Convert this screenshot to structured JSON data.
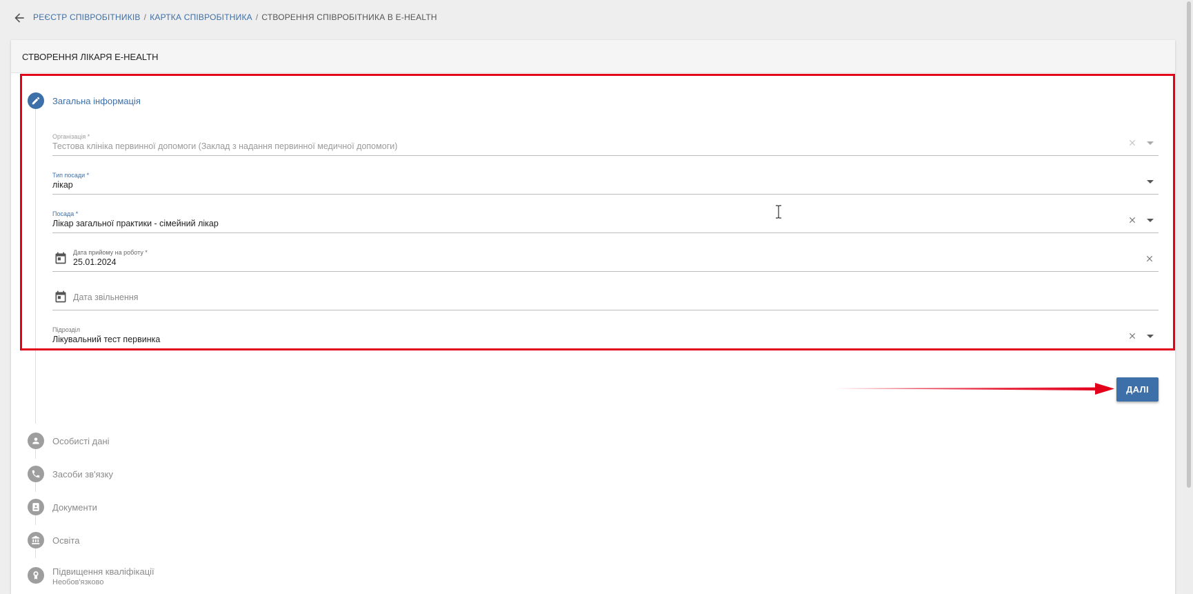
{
  "breadcrumb": {
    "items": [
      "РЕЄСТР СПІВРОБІТНИКІВ",
      "КАРТКА СПІВРОБІТНИКА"
    ],
    "current": "СТВОРЕННЯ СПІВРОБІТНИКА В E-HEALTH",
    "separator": "/"
  },
  "card": {
    "title": "СТВОРЕННЯ ЛІКАРЯ E-HEALTH"
  },
  "steps": [
    {
      "title": "Загальна інформація",
      "icon": "pencil-icon",
      "state": "active"
    },
    {
      "title": "Особисті дані",
      "icon": "person-icon",
      "state": "inactive"
    },
    {
      "title": "Засоби зв'язку",
      "icon": "phone-icon",
      "state": "inactive"
    },
    {
      "title": "Документи",
      "icon": "id-card-icon",
      "state": "inactive"
    },
    {
      "title": "Освіта",
      "icon": "institution-icon",
      "state": "inactive"
    },
    {
      "title": "Підвищення кваліфікації",
      "icon": "award-icon",
      "state": "inactive",
      "subtitle": "Необов'язково"
    }
  ],
  "form": {
    "organization": {
      "label": "Організація *",
      "value": "Тестова клініка первинної допомоги (Заклад з надання первинної медичної допомоги)",
      "disabled": true
    },
    "position_type": {
      "label": "Тип посади *",
      "value": "лікар"
    },
    "position": {
      "label": "Посада *",
      "value": "Лікар загальної практики - сімейний лікар"
    },
    "hire_date": {
      "label": "Дата прийому на роботу *",
      "value": "25.01.2024"
    },
    "dismissal_date": {
      "placeholder": "Дата звільнення"
    },
    "division": {
      "label": "Підрозділ",
      "value": "Лікувальний тест первинка"
    }
  },
  "buttons": {
    "next_label": "ДАЛІ"
  },
  "colors": {
    "accent": "#3d6fa8",
    "highlight": "#e3001b",
    "inactive_step": "#9e9e9e",
    "background": "#eeeeee"
  }
}
